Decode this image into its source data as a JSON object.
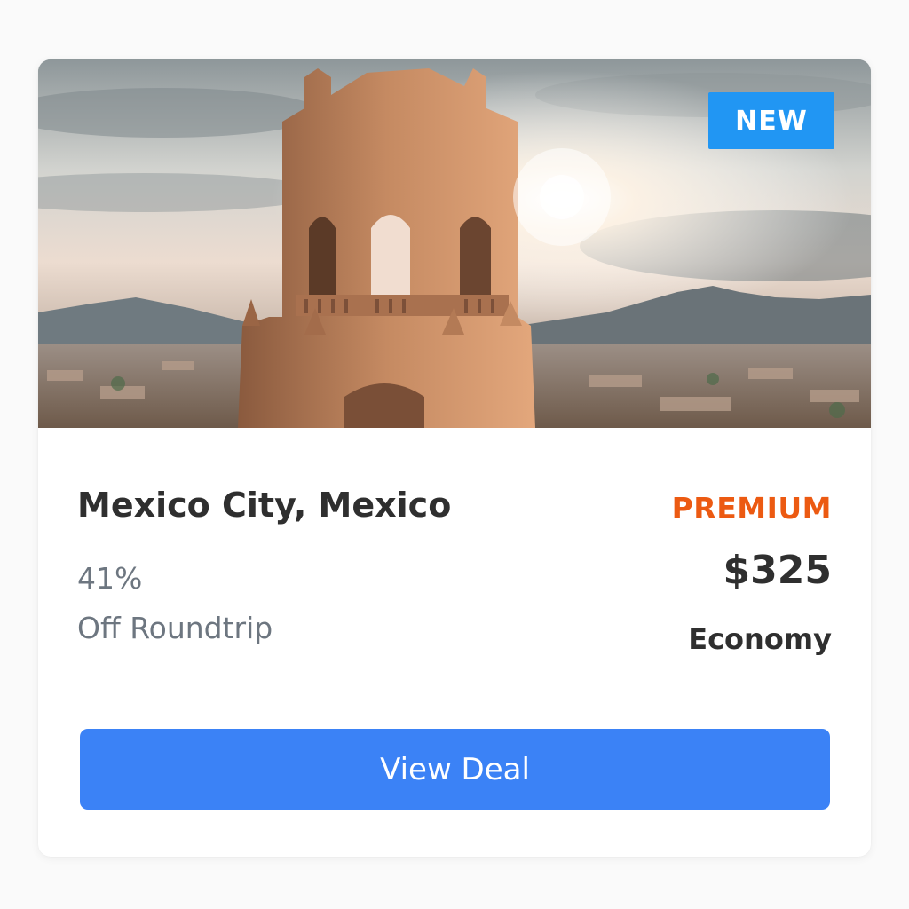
{
  "deal": {
    "badge": "NEW",
    "destination": "Mexico City, Mexico",
    "discount_percent": "41%",
    "discount_label": "Off Roundtrip",
    "tier": "PREMIUM",
    "price": "$325",
    "cabin": "Economy",
    "cta_label": "View Deal",
    "image_subject": "cathedral-bell-tower-at-sunset"
  },
  "colors": {
    "badge_bg": "#2196f3",
    "tier_text": "#ec5a12",
    "cta_bg": "#3b82f6",
    "title_text": "#2f2f2f",
    "muted_text": "#6d7680"
  }
}
